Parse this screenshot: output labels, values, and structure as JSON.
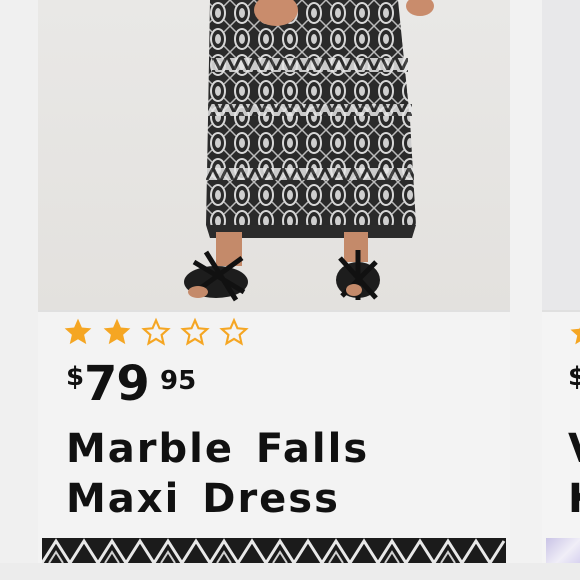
{
  "product": {
    "rating": 2,
    "rating_max": 5,
    "price_currency": "$",
    "price_dollars": "79",
    "price_cents": "95",
    "title_line1": "Marble Falls",
    "title_line2": "Maxi Dress"
  },
  "next_product": {
    "price_currency": "$",
    "title_line1_partial": "V",
    "title_line2_partial": "K"
  },
  "colors": {
    "star_filled": "#f5a623",
    "star_outline": "#f5a623",
    "text": "#111111",
    "card_bg": "#f3f3f3"
  },
  "icons": {
    "star_filled": "star-filled-icon",
    "star_empty": "star-outline-icon"
  }
}
